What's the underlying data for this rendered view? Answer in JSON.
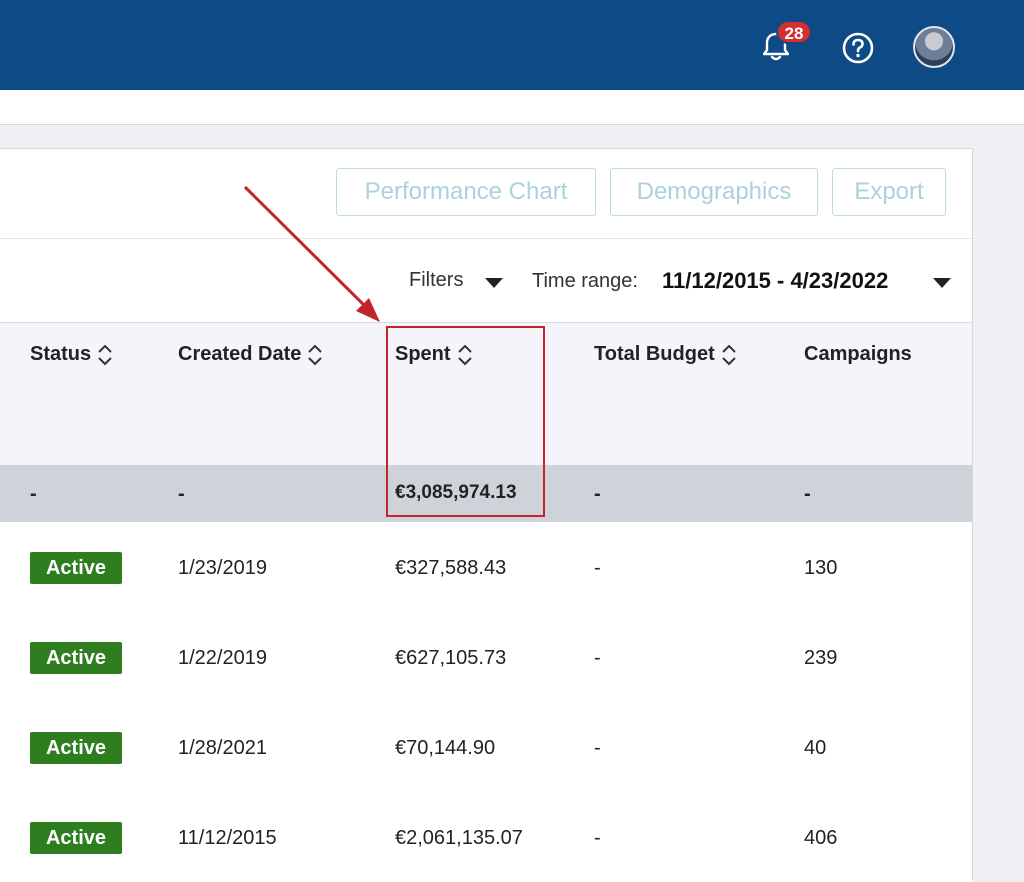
{
  "header": {
    "notification_count": "28",
    "icons": [
      "bell-icon",
      "help-icon",
      "avatar"
    ]
  },
  "toolbar": {
    "performance_chart": "Performance Chart",
    "demographics": "Demographics",
    "export": "Export"
  },
  "filters": {
    "label": "Filters",
    "time_range_label": "Time range:",
    "time_range_value": "11/12/2015 - 4/23/2022"
  },
  "table": {
    "columns": {
      "status": "Status",
      "created_date": "Created Date",
      "spent": "Spent",
      "total_budget": "Total Budget",
      "campaigns": "Campaigns"
    },
    "totals": {
      "status": "-",
      "created_date": "-",
      "spent": "€3,085,974.13",
      "total_budget": "-",
      "campaigns": "-"
    },
    "rows": [
      {
        "status": "Active",
        "created_date": "1/23/2019",
        "spent": "€327,588.43",
        "total_budget": "-",
        "campaigns": "130"
      },
      {
        "status": "Active",
        "created_date": "1/22/2019",
        "spent": "€627,105.73",
        "total_budget": "-",
        "campaigns": "239"
      },
      {
        "status": "Active",
        "created_date": "1/28/2021",
        "spent": "€70,144.90",
        "total_budget": "-",
        "campaigns": "40"
      },
      {
        "status": "Active",
        "created_date": "11/12/2015",
        "spent": "€2,061,135.07",
        "total_budget": "-",
        "campaigns": "406"
      }
    ]
  },
  "colors": {
    "topbar": "#0d4a86",
    "status_active": "#2e7d1f",
    "annotation": "#c0262c",
    "notification": "#d32f2f"
  }
}
